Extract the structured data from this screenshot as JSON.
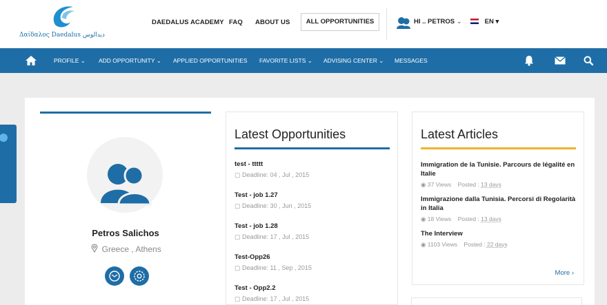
{
  "brand": {
    "logo_text": "Δαίδαλος Daedalus دیدالوس"
  },
  "topnav": {
    "academy": "DAEDALUS ACADEMY",
    "faq": "FAQ",
    "about": "ABOUT US",
    "all_opportunities": "ALL OPPORTUNITIES",
    "user_greeting": "HI .. PETROS",
    "language": "EN"
  },
  "nav": {
    "profile": "PROFILE",
    "add_opportunity": "ADD OPPORTUNITY",
    "applied": "APPLIED OPPORTUNITIES",
    "favorites": "FAVORITE LISTS",
    "advising": "ADVISING CENTER",
    "messages": "MESSAGES"
  },
  "profile": {
    "name": "Petros Salichos",
    "location": "Greece , Athens"
  },
  "opportunities": {
    "title": "Latest Opportunities",
    "items": [
      {
        "title": "test - ttttt",
        "deadline": "Deadline: 04 , Jul , 2015"
      },
      {
        "title": "Test - job 1.27",
        "deadline": "Deadline: 30 , Jun , 2015"
      },
      {
        "title": "Test - job 1.28",
        "deadline": "Deadline: 17 , Jul , 2015"
      },
      {
        "title": "Test-Opp26",
        "deadline": "Deadline: 11 , Sep , 2015"
      },
      {
        "title": "Test - Opp2.2",
        "deadline": "Deadline: 17 , Jul , 2015"
      }
    ]
  },
  "articles": {
    "title": "Latest Articles",
    "items": [
      {
        "title": "Immigration de la Tunisie. Parcours de légalité en Italie",
        "views": "37 Views",
        "posted_label": "Posted :",
        "posted": "13 days"
      },
      {
        "title": "Immigrazione dalla Tunisia. Percorsi di Regolarità in Italia",
        "views": "18 Views",
        "posted_label": "Posted :",
        "posted": "13 days"
      },
      {
        "title": "The Interview",
        "views": "1103 Views",
        "posted_label": "Posted :",
        "posted": "22 days"
      }
    ],
    "more": "More"
  },
  "colors": {
    "primary": "#1f6da6",
    "accent": "#f0b429"
  },
  "icons": [
    "logo-icon",
    "home-icon",
    "bell-icon",
    "envelope-icon",
    "search-icon",
    "calendar-icon",
    "eye-icon",
    "location-icon",
    "message-icon",
    "settings-icon",
    "user-avatar-icon",
    "flag-icon"
  ]
}
